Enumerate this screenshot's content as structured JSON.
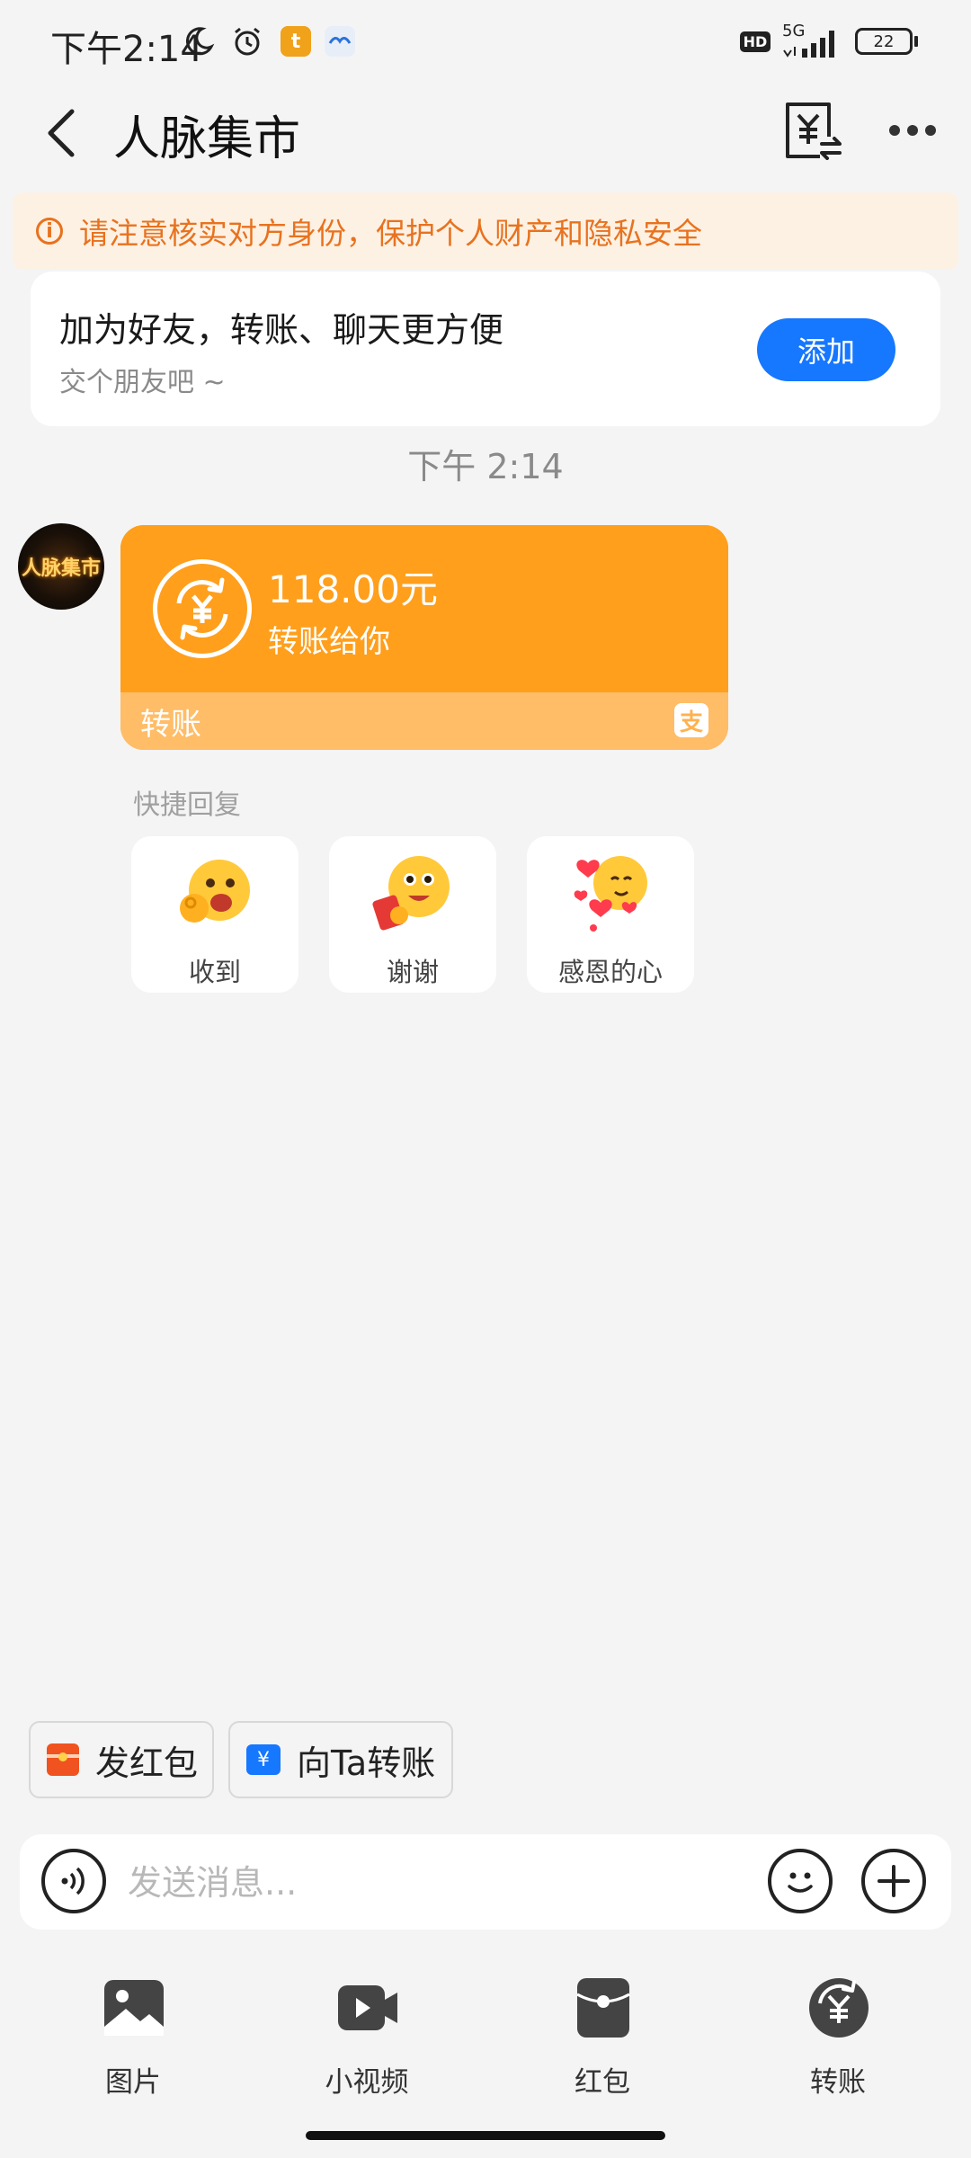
{
  "status_bar": {
    "time": "下午2:14",
    "hd": "HD",
    "network": "5G",
    "battery": "22"
  },
  "header": {
    "title": "人脉集市"
  },
  "warning": {
    "text": "请注意核实对方身份，保护个人财产和隐私安全"
  },
  "friend_card": {
    "title": "加为好友，转账、聊天更方便",
    "subtitle": "交个朋友吧 ~",
    "add_label": "添加"
  },
  "chat": {
    "timestamp": "下午 2:14",
    "avatar_text": "人脉集市",
    "transfer": {
      "amount": "118.00元",
      "description": "转账给你",
      "type_label": "转账",
      "accent": "#ff9f1c"
    }
  },
  "quick_reply": {
    "label": "快捷回复",
    "items": [
      {
        "label": "收到",
        "icon": "ok-hand-emoji"
      },
      {
        "label": "谢谢",
        "icon": "red-packet-emoji"
      },
      {
        "label": "感恩的心",
        "icon": "hearts-emoji"
      }
    ]
  },
  "shortcuts": {
    "red_packet_label": "发红包",
    "transfer_label": "向Ta转账"
  },
  "input": {
    "placeholder": "发送消息..."
  },
  "toolbar": {
    "items": [
      {
        "label": "图片",
        "icon": "image-icon"
      },
      {
        "label": "小视频",
        "icon": "video-icon"
      },
      {
        "label": "红包",
        "icon": "red-packet-icon"
      },
      {
        "label": "转账",
        "icon": "transfer-icon"
      }
    ]
  }
}
